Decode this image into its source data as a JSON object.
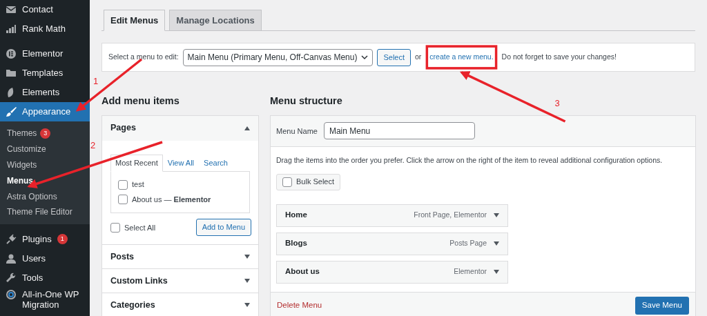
{
  "sidebar": {
    "items": [
      {
        "label": "Contact",
        "selected": false
      },
      {
        "label": "Rank Math",
        "selected": false
      },
      {
        "label": "Elementor",
        "selected": false
      },
      {
        "label": "Templates",
        "selected": false
      },
      {
        "label": "Elements",
        "selected": false
      },
      {
        "label": "Appearance",
        "selected": true,
        "children": [
          {
            "label": "Themes",
            "badge": "3",
            "selected": false
          },
          {
            "label": "Customize",
            "selected": false
          },
          {
            "label": "Widgets",
            "selected": false
          },
          {
            "label": "Menus",
            "selected": true
          },
          {
            "label": "Astra Options",
            "selected": false
          },
          {
            "label": "Theme File Editor",
            "selected": false
          }
        ]
      },
      {
        "label": "Plugins",
        "badge": "1",
        "selected": false
      },
      {
        "label": "Users",
        "selected": false
      },
      {
        "label": "Tools",
        "selected": false
      },
      {
        "label": "All-in-One WP Migration",
        "selected": false
      }
    ]
  },
  "tabs": [
    {
      "label": "Edit Menus",
      "selected": true
    },
    {
      "label": "Manage Locations",
      "selected": false
    }
  ],
  "manage_bar": {
    "label": "Select a menu to edit:",
    "dropdown": "Main Menu (Primary Menu, Off-Canvas Menu)",
    "button": "Select",
    "text_before": "or",
    "link": "create a new menu.",
    "text_after": "Do not forget to save your changes!"
  },
  "add_items": {
    "title": "Add menu items",
    "panels": [
      {
        "title": "Pages",
        "expanded": true,
        "tabs": [
          {
            "label": "Most Recent",
            "selected": true
          },
          {
            "label": "View All",
            "selected": false
          },
          {
            "label": "Search",
            "selected": false
          }
        ],
        "items": [
          {
            "label": "test",
            "checked": false
          },
          {
            "label": "About us — **Elementor**",
            "checked": false
          }
        ],
        "select_all": {
          "label": "Select All",
          "checked": false
        },
        "button": "Add to Menu"
      },
      {
        "title": "Posts",
        "expanded": false
      },
      {
        "title": "Custom Links",
        "expanded": false
      },
      {
        "title": "Categories",
        "expanded": false
      }
    ]
  },
  "structure": {
    "title": "Menu structure",
    "name_label": "Menu Name",
    "name_value": "Main Menu",
    "instructions": "Drag the items into the order you prefer. Click the arrow on the right of the item to reveal additional configuration options.",
    "bulk_select": {
      "label": "Bulk Select",
      "checked": false
    },
    "items": [
      {
        "title": "Home",
        "meta": "Front Page, Elementor"
      },
      {
        "title": "Blogs",
        "meta": "Posts Page"
      },
      {
        "title": "About us",
        "meta": "Elementor"
      }
    ],
    "delete": "Delete Menu",
    "save": "Save Menu"
  },
  "callouts": [
    {
      "number": "1"
    },
    {
      "number": "2"
    },
    {
      "number": "3"
    }
  ]
}
